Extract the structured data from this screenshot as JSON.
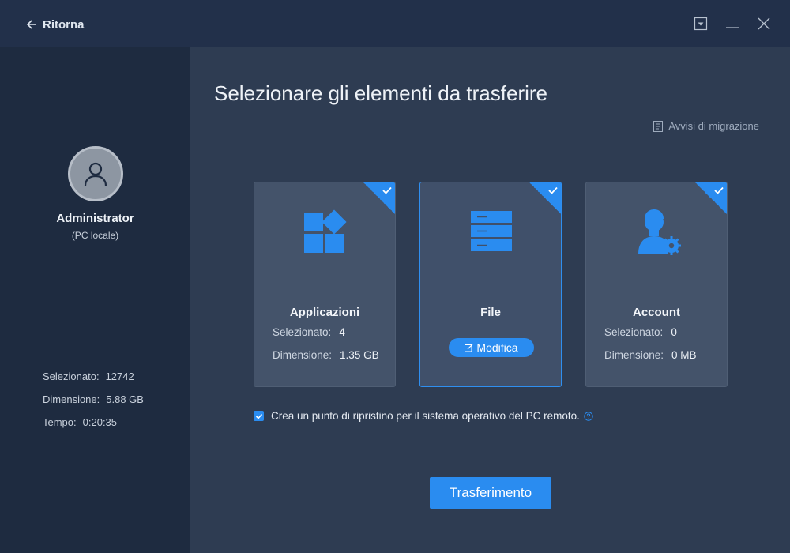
{
  "header": {
    "back_label": "Ritorna"
  },
  "sidebar": {
    "user_name": "Administrator",
    "user_subtitle": "(PC locale)",
    "stats": [
      {
        "label": "Selezionato:",
        "value": "12742"
      },
      {
        "label": "Dimensione:",
        "value": "5.88 GB"
      },
      {
        "label": "Tempo:",
        "value": "0:20:35"
      }
    ]
  },
  "main": {
    "title": "Selezionare gli elementi da trasferire",
    "notes_link": "Avvisi di migrazione",
    "cards": [
      {
        "title": "Applicazioni",
        "selected_label": "Selezionato:",
        "selected_value": "4",
        "size_label": "Dimensione:",
        "size_value": "1.35 GB",
        "checked": true,
        "icon": "apps-icon"
      },
      {
        "title": "File",
        "edit_label": "Modifica",
        "checked": true,
        "icon": "files-icon"
      },
      {
        "title": "Account",
        "selected_label": "Selezionato:",
        "selected_value": "0",
        "size_label": "Dimensione:",
        "size_value": "0 MB",
        "checked": true,
        "icon": "account-settings-icon"
      }
    ],
    "restore_point_label": "Crea un punto di ripristino per il sistema operativo del PC remoto.",
    "restore_point_checked": true,
    "transfer_button": "Trasferimento"
  },
  "colors": {
    "accent": "#2a8cf0",
    "background": "#2e3c52",
    "sidebar": "#1e2b40",
    "titlebar": "#22304a",
    "card": "#44536a"
  }
}
